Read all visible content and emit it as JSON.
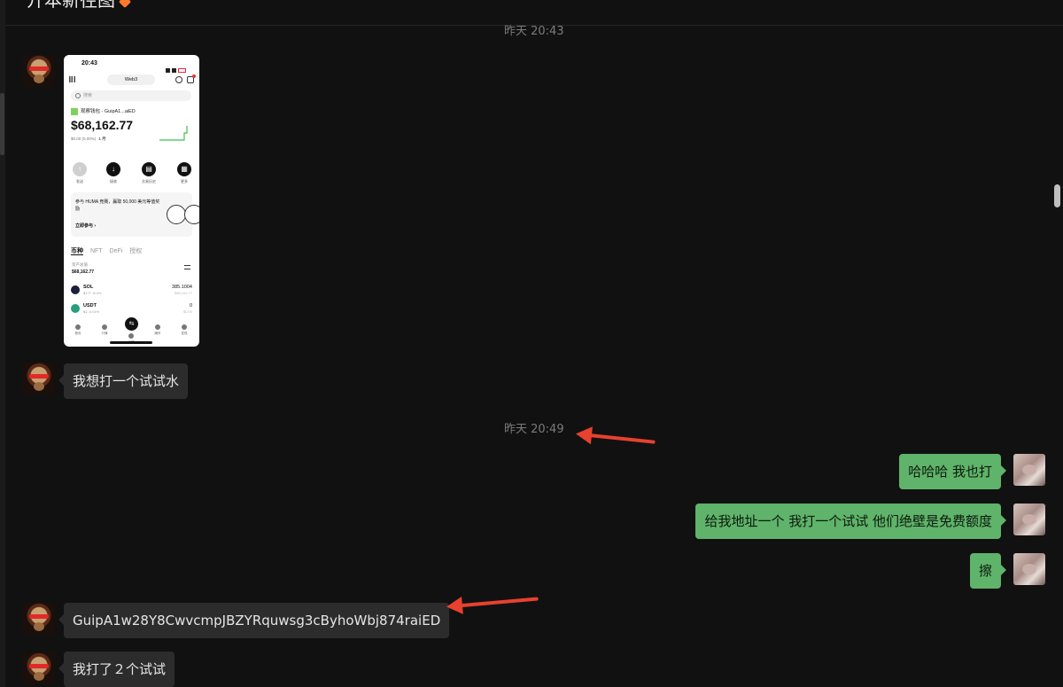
{
  "header": {
    "title": "开本新径图"
  },
  "timestamps": [
    "昨天 20:43",
    "昨天 20:49"
  ],
  "phone": {
    "status_time": "20:43",
    "network_label": "Web3",
    "search_placeholder": "搜索",
    "wallet_name": "观察钱包 - GuipA1...aiED",
    "balance": "$68,162.77",
    "change": "$0.00 (0.00%)",
    "period": "1 月",
    "actions": [
      "发送",
      "接收",
      "交易历史",
      "更多"
    ],
    "promo_text": "参与 HUMA 竞赛，赢取 50,000 美元等值奖励",
    "promo_cta": "立即参与 ›",
    "tabs": [
      "币种",
      "NFT",
      "DeFi",
      "授权"
    ],
    "total_label": "资产总值",
    "total_value": "$68,162.77",
    "tokens": [
      {
        "name": "SOL",
        "sub": "$177  -8.4%",
        "amount": "385.1004",
        "usd": "$68,162.77",
        "color": "#1b1f3a"
      },
      {
        "name": "USDT",
        "sub": "$1  -0.01%",
        "amount": "0",
        "usd": "$0.00",
        "color": "#26a17b"
      }
    ],
    "nav": [
      "首页",
      "行情",
      "交易",
      "赚币",
      "发现"
    ],
    "nav_center_icon": "swap-icon"
  },
  "messages": [
    {
      "side": "in",
      "text": "我想打一个试试水"
    },
    {
      "side": "out",
      "text": "哈哈哈 我也打"
    },
    {
      "side": "out",
      "text": "给我地址一个 我打一个试试 他们绝壁是免费额度"
    },
    {
      "side": "out",
      "text": "擦"
    },
    {
      "side": "in",
      "text": "GuipA1w28Y8CwvcmpJBZYRquwsg3cByhoWbj874raiED"
    },
    {
      "side": "in",
      "text": "我打了２个试试"
    }
  ],
  "colors": {
    "outgoing_bubble": "#5fb36a",
    "incoming_bubble": "#2c2c2c",
    "annotation_arrow": "#e8412f",
    "background": "#111111"
  }
}
